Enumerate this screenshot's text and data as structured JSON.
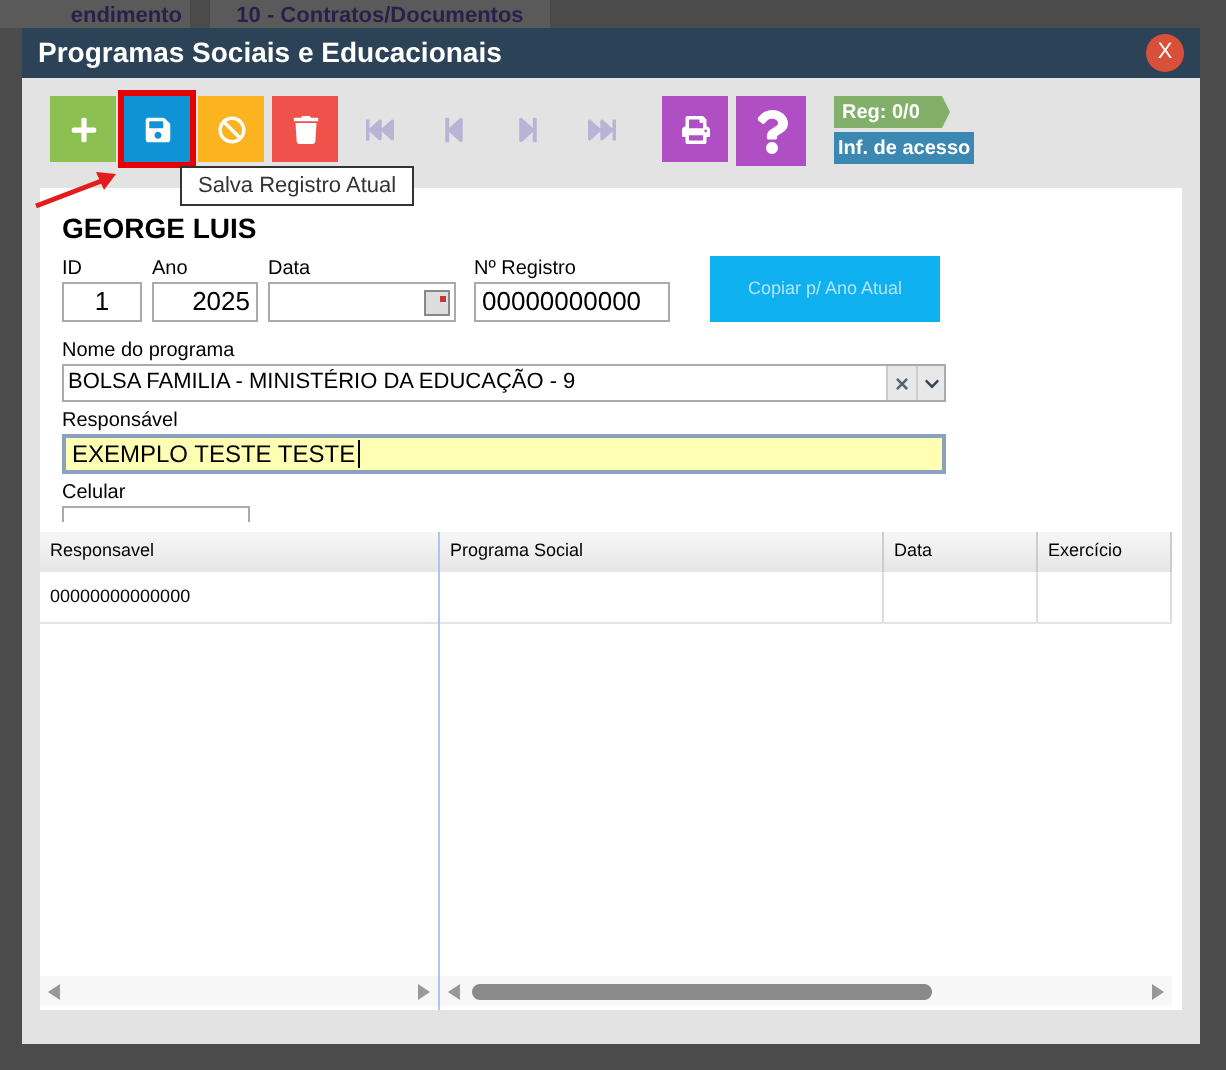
{
  "background_tabs": [
    "endimento",
    "10 - Contratos/Documentos"
  ],
  "dialog": {
    "title": "Programas Sociais e Educacionais",
    "close": "X"
  },
  "toolbar": {
    "buttons": [
      {
        "kind": "add",
        "selected": false,
        "disabled": false
      },
      {
        "kind": "save",
        "selected": true,
        "disabled": false
      },
      {
        "kind": "cancel",
        "selected": false,
        "disabled": false
      },
      {
        "kind": "delete",
        "selected": false,
        "disabled": false
      },
      {
        "kind": "first",
        "selected": false,
        "disabled": true
      },
      {
        "kind": "prev",
        "selected": false,
        "disabled": true
      },
      {
        "kind": "next",
        "selected": false,
        "disabled": true
      },
      {
        "kind": "last",
        "selected": false,
        "disabled": true
      },
      {
        "kind": "print",
        "selected": false,
        "disabled": false
      },
      {
        "kind": "help",
        "selected": false,
        "disabled": false
      }
    ],
    "tooltip": "Salva Registro Atual",
    "record_counter": "Reg: 0/0",
    "access_info": "Inf. de acesso"
  },
  "form": {
    "person_name": "GEORGE LUIS",
    "fields": [
      {
        "label": "ID",
        "value": "1",
        "kind": "number"
      },
      {
        "label": "Ano",
        "value": "2025",
        "kind": "number"
      },
      {
        "label": "Data",
        "kind": "date"
      },
      {
        "label": "Nº Registro",
        "value": "00000000000",
        "kind": "text"
      }
    ],
    "copy_button": {
      "label": "Copiar p/ Ano Atual",
      "disabled": true
    },
    "program": {
      "label": "Nome do programa",
      "value": "BOLSA FAMILIA - MINISTÉRIO DA EDUCAÇÃO - 9",
      "clear": "×"
    },
    "responsible": {
      "label": "Responsável",
      "value": "EXEMPLO TESTE TESTE",
      "focused": true
    },
    "phone": {
      "label": "Celular"
    }
  },
  "grid": {
    "frozen_column": "Responsavel",
    "columns": [
      "Programa Social",
      "Data",
      "Exercício"
    ],
    "rows": [
      {
        "cells": [
          "00000000000000"
        ]
      }
    ]
  }
}
